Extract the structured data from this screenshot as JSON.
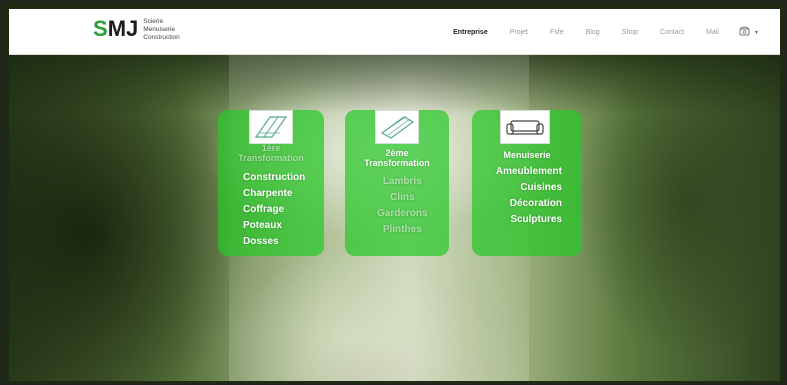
{
  "logo": {
    "mark_s": "S",
    "mark_mj": "MJ",
    "sub": [
      "Scierie",
      "Menuiserie",
      "Construction"
    ]
  },
  "nav": {
    "items": [
      "Entreprise",
      "Projet",
      "Fsfe",
      "Blog",
      "Shop",
      "Contact",
      "Mail"
    ],
    "active": "Entreprise",
    "phone_icon": "phone-icon",
    "caret": "▾"
  },
  "cards": [
    {
      "title": "1ère\nTransformation",
      "icon": "planks-icon",
      "items": [
        "Construction",
        "Charpente",
        "Coffrage",
        "Poteaux",
        "Dosses"
      ]
    },
    {
      "title": "2ème\nTransformation",
      "icon": "board-icon",
      "items": [
        "Lambris",
        "Clins",
        "Garderons",
        "Plinthes"
      ]
    },
    {
      "title": "Menuiserie",
      "icon": "sofa-icon",
      "items": [
        "Ameublement",
        "Cuisines",
        "Décoration",
        "Sculptures"
      ]
    }
  ],
  "colors": {
    "brand_green": "#2e9e3a",
    "card_green": "#28c828"
  }
}
